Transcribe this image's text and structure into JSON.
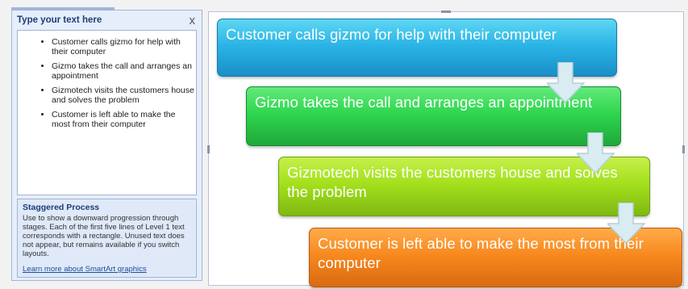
{
  "text_pane": {
    "title": "Type your text here",
    "close_glyph": "x",
    "bullets": [
      "Customer calls gizmo for help with their computer",
      "Gizmo takes the call and arranges an appointment",
      "Gizmotech visits the customers house and solves the problem",
      "Customer is left able to make the most from their computer"
    ]
  },
  "layout_info": {
    "title": "Staggered Process",
    "description": "Use to show a downward progression through stages. Each of the first five lines of Level 1 text corresponds with a rectangle. Unused text does not appear, but remains available if you switch layouts.",
    "link": "Learn more about SmartArt graphics"
  },
  "diagram": {
    "steps": [
      {
        "text": "Customer calls gizmo for help with their computer",
        "color": "#2bb5e6"
      },
      {
        "text": "Gizmo takes the call and arranges an appointment",
        "color": "#2fd64f"
      },
      {
        "text": "Gizmotech visits the customers house and solves the problem",
        "color": "#a4e01d"
      },
      {
        "text": "Customer is left able to make the most from their computer",
        "color": "#f7891f"
      }
    ],
    "arrow_color": "#d8ecf2"
  },
  "icons": [
    "close-icon",
    "down-arrow-icon"
  ]
}
